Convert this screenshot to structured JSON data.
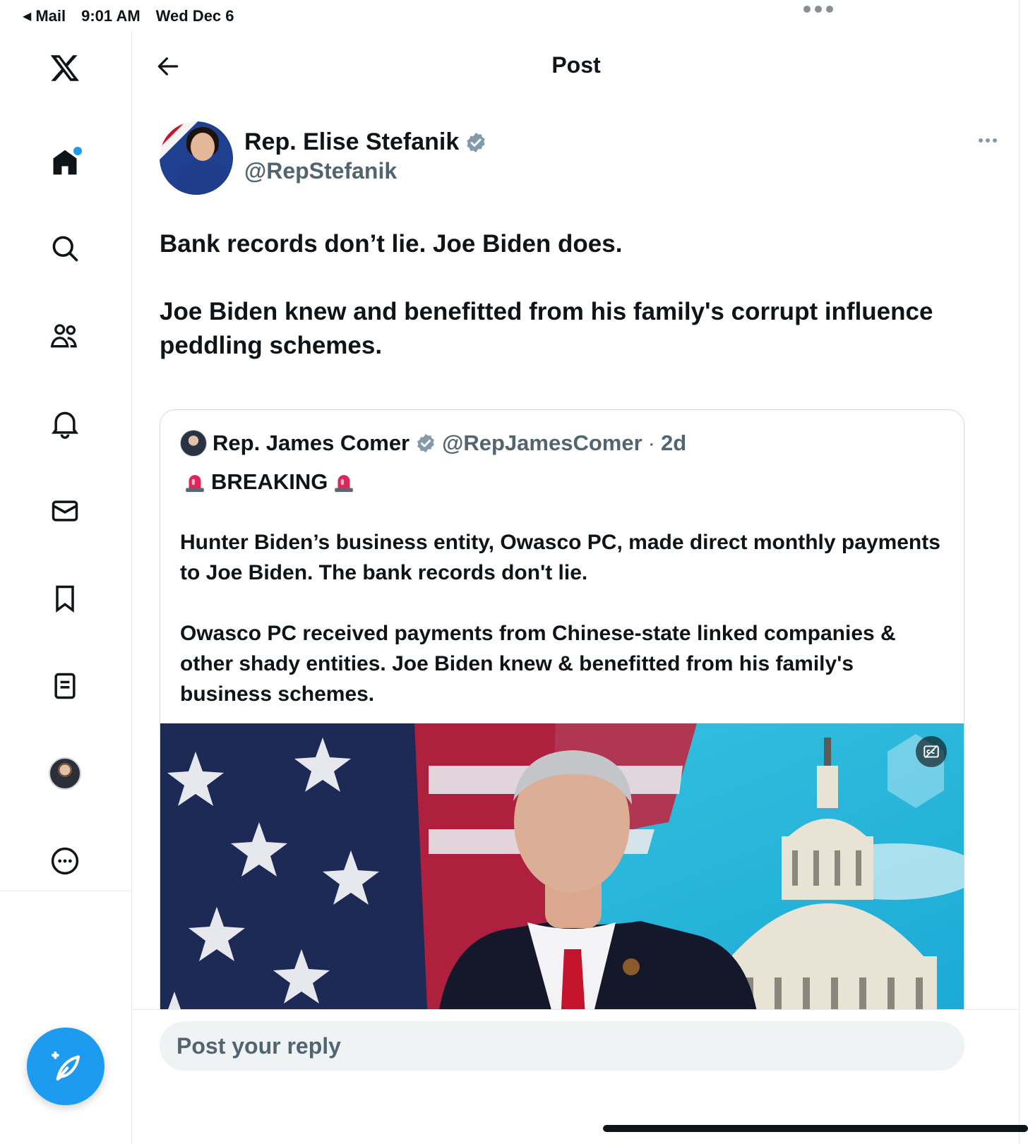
{
  "status_bar": {
    "back_app": "Mail",
    "time": "9:01 AM",
    "date": "Wed Dec 6"
  },
  "sidebar": {
    "items": [
      {
        "name": "x-logo",
        "icon": "x-logo-icon"
      },
      {
        "name": "home",
        "icon": "home-icon",
        "unread_dot": true
      },
      {
        "name": "explore",
        "icon": "search-icon"
      },
      {
        "name": "communities",
        "icon": "communities-icon"
      },
      {
        "name": "notifications",
        "icon": "bell-icon"
      },
      {
        "name": "messages",
        "icon": "mail-icon"
      },
      {
        "name": "bookmarks",
        "icon": "bookmark-icon"
      },
      {
        "name": "lists",
        "icon": "list-icon"
      },
      {
        "name": "profile",
        "icon": "avatar"
      },
      {
        "name": "more",
        "icon": "more-circle-icon"
      }
    ],
    "compose_icon": "compose-feather-icon"
  },
  "header": {
    "title": "Post"
  },
  "post": {
    "author_name": "Rep. Elise Stefanik",
    "author_handle": "@RepStefanik",
    "text": "Bank records don’t lie. Joe Biden does.\n\nJoe Biden knew and benefitted from his family's corrupt influence peddling schemes."
  },
  "quote": {
    "author_name": "Rep. James Comer",
    "author_handle": "@RepJamesComer",
    "separator": "·",
    "time": "2d",
    "headline": "BREAKING",
    "text": "Hunter Biden’s business entity, Owasco PC, made direct monthly payments to Joe Biden. The bank records don't lie.\n\nOwasco PC received payments from Chinese-state linked companies & other shady entities. Joe Biden knew & benefitted from his family's business schemes."
  },
  "reply": {
    "placeholder": "Post your reply"
  },
  "colors": {
    "accent": "#1d9bf0",
    "text": "#0f1419",
    "secondary_text": "#536471",
    "verified_gray": "#829aab"
  }
}
